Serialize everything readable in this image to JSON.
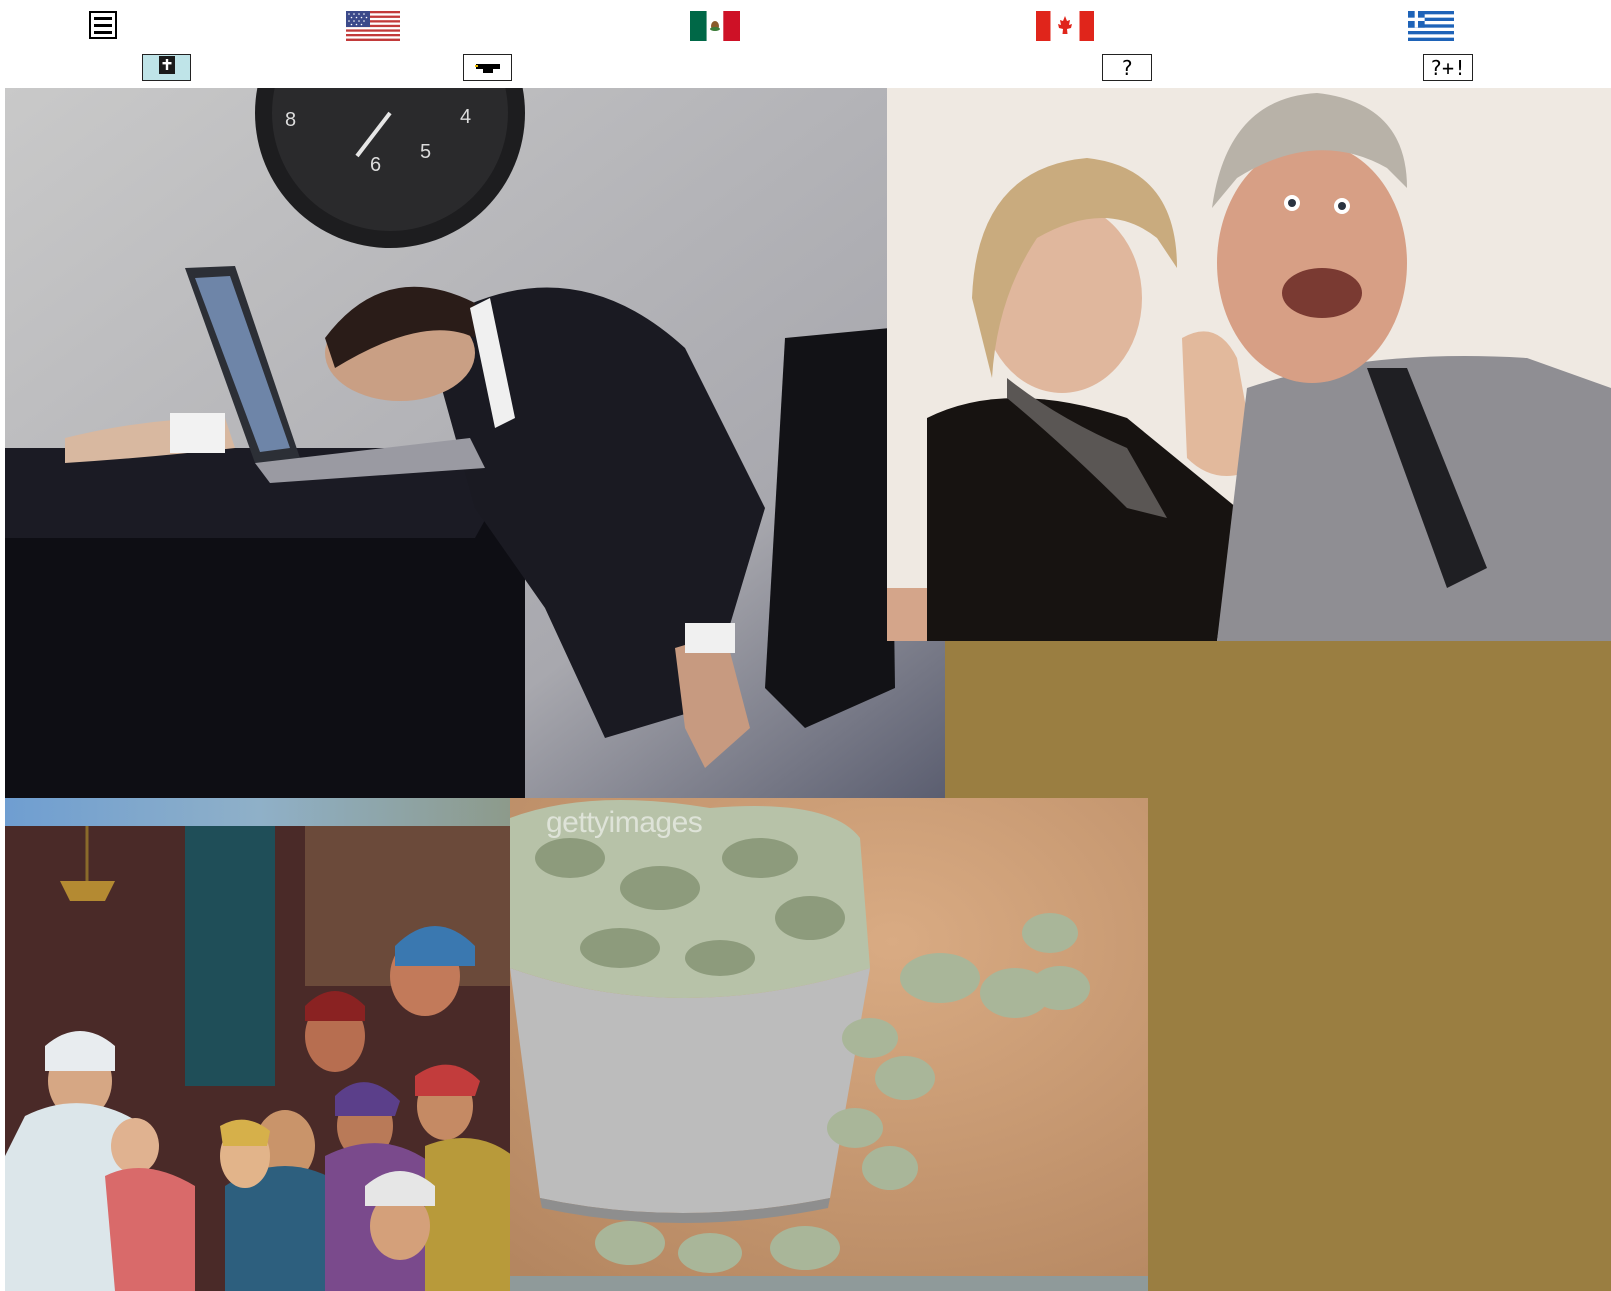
{
  "toolbar": {
    "menu_icon": "hamburger-menu-icon",
    "flags": [
      {
        "name": "usa-flag-icon"
      },
      {
        "name": "mexico-flag-icon"
      },
      {
        "name": "canada-flag-icon"
      },
      {
        "name": "greece-flag-icon"
      }
    ],
    "buttons": [
      {
        "name": "bible-icon",
        "label": ""
      },
      {
        "name": "graduation-cap-icon",
        "label": ""
      },
      {
        "name": "question-button",
        "label": "?"
      },
      {
        "name": "question-plus-exclaim-button",
        "label": "?+!"
      }
    ]
  },
  "mosaic": {
    "images": [
      {
        "name": "sleeping-businessman-photo"
      },
      {
        "name": "elderly-couple-whisper-photo"
      },
      {
        "name": "biblical-gathering-painting"
      },
      {
        "name": "money-wastebasket-photo",
        "watermark": "gettyimages"
      }
    ],
    "background_color": "#9a7e41"
  },
  "colors": {
    "greece_blue": "#1e63b8",
    "usa_red": "#c23a3a",
    "mexico_green": "#006847",
    "canada_red": "#e0251b"
  }
}
